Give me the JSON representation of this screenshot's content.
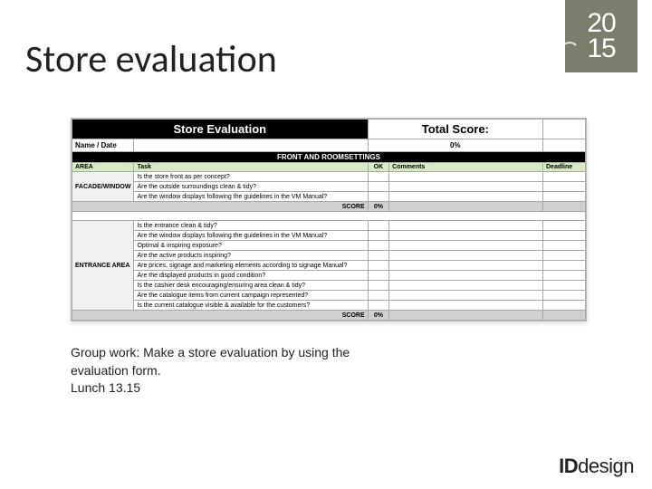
{
  "title": "Store evaluation",
  "logo": {
    "line1": "20",
    "line2": "15"
  },
  "sheet": {
    "header_left": "Store Evaluation",
    "header_right": "Total Score:",
    "pct": "0%",
    "name_date_label": "Name / Date",
    "section1": "FRONT AND ROOMSETTINGS",
    "cols": {
      "area": "AREA",
      "task": "Task",
      "ok": "OK",
      "comments": "Comments",
      "deadline": "Deadline"
    },
    "area1": "FACADE/WINDOW",
    "rows1": [
      "Is the store front as per concept?",
      "Are the outside surroundings clean & tidy?",
      "Are the window displays following the guidelines in the VM Manual?"
    ],
    "score_label": "SCORE",
    "score1": "0%",
    "area2": "ENTRANCE AREA",
    "rows2": [
      "Is the entrance clean & tidy?",
      "Are the window displays following the guidelines in the VM Manual?",
      "Optimal & inspiring exposure?",
      "Are the active products inspiring?",
      "Are prices, signage and marketing elements according to signage Manual?",
      "Are the displayed products in good condition?",
      "Is the cashier desk encouraging/ensuring area clean & tidy?",
      "Are the catalogue items from current campaign represented?",
      "Is the current catalogue visible & available for the customers?"
    ],
    "score2": "0%"
  },
  "group_text": {
    "line1": "Group work: Make a store evaluation by using the",
    "line2": "evaluation form.",
    "line3": "Lunch 13.15"
  },
  "brand": {
    "id": "ID",
    "design": "design"
  }
}
